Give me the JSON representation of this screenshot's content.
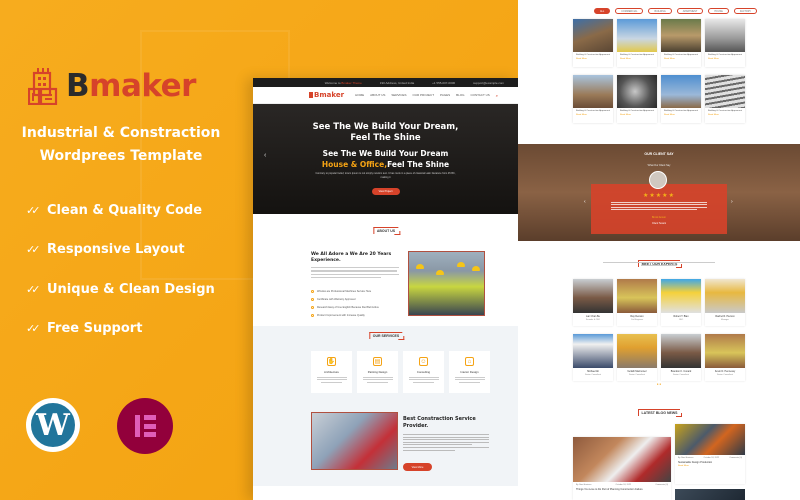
{
  "promo": {
    "brand_first": "B",
    "brand_rest": "maker",
    "tagline_line1": "Industrial & Constraction",
    "tagline_line2": "Wordprees Template",
    "features": [
      "Clean & Quality Code",
      "Responsive Layout",
      "Unique & Clean Design",
      "Free Support"
    ],
    "platforms": [
      {
        "name": "WordPress",
        "glyph": "W",
        "color": "#21759b"
      },
      {
        "name": "Elementor",
        "color": "#92003b"
      }
    ],
    "colors": {
      "background": "#f5a314",
      "accent": "#d6432a",
      "dark": "#2b2b2b"
    }
  },
  "home_preview": {
    "topbar": {
      "welcome": "Welcome to",
      "welcome_highlight": "Bmaker Theme",
      "address": "190 Address, United India",
      "phone": "+1 555-007-0006",
      "email": "support@example.com"
    },
    "nav": {
      "logo": "Bmaker",
      "menu": [
        "HOME",
        "ABOUT US",
        "SERVICES",
        "OUR PROJECT",
        "PAGES",
        "BLOG",
        "CONTACT US"
      ],
      "search_icon": "search-icon"
    },
    "hero": {
      "title_line1": "See The We Build Your Dream,",
      "title_line2": "Feel The Shine",
      "sub_line1": "See The We Build Your Dream",
      "sub_highlight": "House & Office,",
      "sub_rest": "Feel The Shine",
      "paragraph": "Contrary to popular belief, lorem ipsum is not simply random text. It has roots in a piece of classical Latin literature from 45 BC, making it",
      "button": "View Project"
    },
    "about": {
      "tag": "ABOUT US",
      "heading_line1": "We All Adore a We Are 20 Years",
      "heading_line2": "Experience.",
      "list": [
        "Window are Professional Machines Service Here",
        "Certificate with Warranty Approved",
        "Research Easy of Use English Because Red Belt Active",
        "Product Improvement with Increase Quality"
      ]
    },
    "services": {
      "tag": "OUR SERVICES",
      "items": [
        {
          "title": "Architecture",
          "icon": "hand-icon"
        },
        {
          "title": "Painting Design",
          "icon": "paint-icon"
        },
        {
          "title": "Consulting",
          "icon": "consult-icon"
        },
        {
          "title": "Interior Design",
          "icon": "interior-icon"
        }
      ]
    },
    "provider": {
      "heading_line1": "Best Constraction Service",
      "heading_line2": "Provider.",
      "button": "View More"
    }
  },
  "inner_preview": {
    "filters": [
      "ALL",
      "COMMERCIAL",
      "BUILDING",
      "APARTMENT",
      "HOUSE",
      "FACTORY"
    ],
    "projects": [
      {
        "title": "Building & Construction Apparment",
        "link": "Read More"
      },
      {
        "title": "Building & Construction Apparment",
        "link": "Read More"
      },
      {
        "title": "Building & Construction Apparment",
        "link": "Read More"
      },
      {
        "title": "Building & Construction Apparment",
        "link": "Read More"
      },
      {
        "title": "Building & Construction Apparment",
        "link": "Read More"
      },
      {
        "title": "Building & Construction Apparment",
        "link": "Read More"
      },
      {
        "title": "Building & Construction Apparment",
        "link": "Read More"
      },
      {
        "title": "Building & Construction Apparment",
        "link": "Read More"
      }
    ],
    "testimonial": {
      "tag": "OUR CLIENT SAY",
      "subtitle": "What Our Client Say",
      "stars": 5,
      "star_glyphs": "★★★★★",
      "name": "Brock Anson",
      "role": "Client Tenant"
    },
    "experts": {
      "tag": "MEET OUR EXPERTS",
      "members": [
        {
          "name": "Lan Chan Be",
          "role": "Founder & CEO"
        },
        {
          "name": "Ray Denson",
          "role": "Civil Engineer"
        },
        {
          "name": "Robert T. Blan",
          "role": "CEO"
        },
        {
          "name": "Rachel R. Pierson",
          "role": "Manager"
        },
        {
          "name": "Michael Alt",
          "role": "Senior Consultant"
        },
        {
          "name": "Verlath Marmonez",
          "role": "Senior Consultant"
        },
        {
          "name": "Brandon K. Conard",
          "role": "Senior Consultant"
        },
        {
          "name": "Kevin D. Hennessy",
          "role": "Senior Consultant"
        }
      ]
    },
    "blog": {
      "tag": "LATEST BLOG NEWS",
      "main": {
        "author": "By Jhon Harrison",
        "date": "October 24, 2022",
        "comments": "Comments (0)",
        "title": "Things You Love to Do Part of Planning Construction Failure"
      },
      "side": {
        "author": "By Jhon Harrison",
        "date": "October 24, 2022",
        "comments": "Comments (0)",
        "title": "Sustainable Design Production",
        "link": "Read More"
      }
    }
  }
}
